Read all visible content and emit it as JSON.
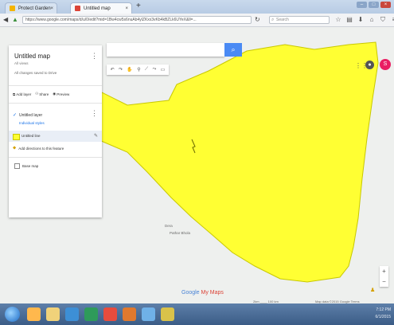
{
  "browser": {
    "tabs": [
      {
        "label": "Protect Garden"
      },
      {
        "label": "Untitled map"
      }
    ],
    "new_tab": "+",
    "url": "https://www.google.com/maps/d/u/0/edit?mid=1Bw4cw5s6nuAb4ylZKxx3vKb4kBZLk6UYeX&ll=...",
    "search_placeholder": "Search",
    "icons": [
      "back-icon",
      "info-icon",
      "star-icon",
      "download-icon",
      "home-icon",
      "shield-icon",
      "menu-icon"
    ]
  },
  "map": {
    "polygon_color": "#ffff33",
    "polygon_stroke": "#c8c800",
    "place_label_1": "Dera",
    "place_label_2": "Pathar Bhola",
    "logo_main": "Google",
    "logo_tail": " My Maps",
    "scale": "2km ____ 100 km",
    "attribution": "Map data ©2015 Google   Terms"
  },
  "panel": {
    "title": "Untitled map",
    "subtitle": "All views",
    "description": "All changes saved to Drive",
    "actions": [
      {
        "icon": "add-layer-icon",
        "label": "Add layer"
      },
      {
        "icon": "share-icon",
        "label": "Share"
      },
      {
        "icon": "preview-icon",
        "label": "Preview"
      }
    ],
    "layer_name": "Untitled layer",
    "style_link": "Individual styles",
    "row1_label": "Untitled line",
    "row2_label": "Add directions to this feature",
    "base_map": "Base map"
  },
  "toolbar": {
    "tools": [
      "undo",
      "redo",
      "select",
      "marker",
      "line",
      "ruler",
      "dir"
    ]
  },
  "user": {
    "avatar_initial": "S"
  },
  "zoom": {
    "in": "+",
    "out": "−"
  },
  "taskbar": {
    "time": "7:12 PM",
    "date": "6/1/2015"
  }
}
